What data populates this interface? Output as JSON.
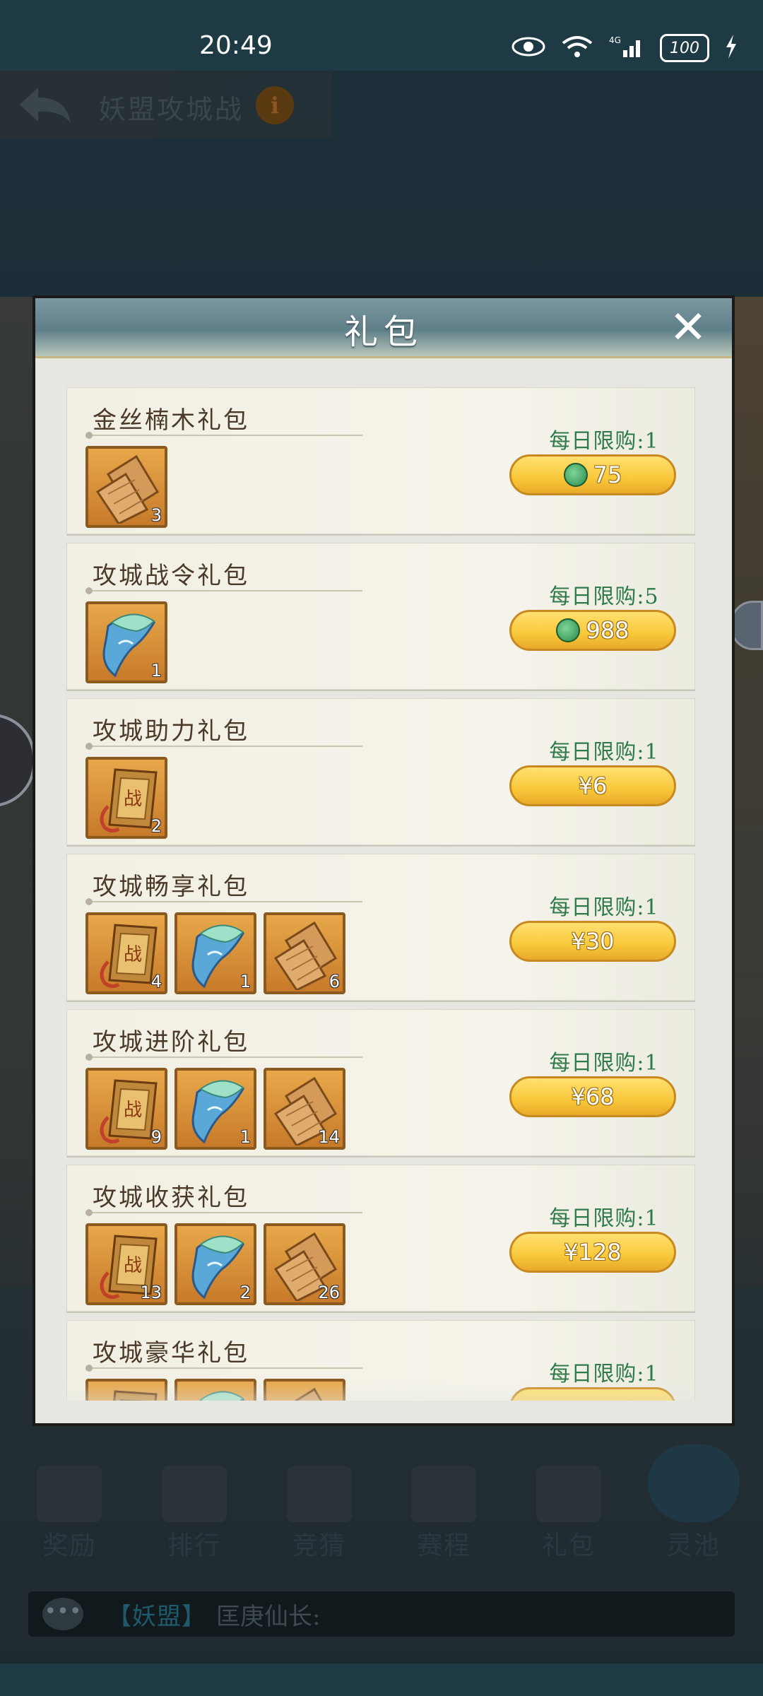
{
  "status_bar": {
    "time": "20:49",
    "battery": "100",
    "network": "4G"
  },
  "header": {
    "title": "妖盟攻城战",
    "info": "i"
  },
  "modal": {
    "title": "礼包",
    "close": "✕",
    "packs": [
      {
        "name": "金丝楠木礼包",
        "limit": "每日限购:1",
        "price": "75",
        "currency": "jade",
        "items": [
          {
            "icon": "wood-plank-icon",
            "count": "3"
          }
        ]
      },
      {
        "name": "攻城战令礼包",
        "limit": "每日限购:5",
        "price": "988",
        "currency": "jade",
        "items": [
          {
            "icon": "blue-shell-icon",
            "count": "1"
          }
        ]
      },
      {
        "name": "攻城助力礼包",
        "limit": "每日限购:1",
        "price": "¥6",
        "currency": "yuan",
        "items": [
          {
            "icon": "war-token-icon",
            "count": "2"
          }
        ]
      },
      {
        "name": "攻城畅享礼包",
        "limit": "每日限购:1",
        "price": "¥30",
        "currency": "yuan",
        "items": [
          {
            "icon": "war-token-icon",
            "count": "4"
          },
          {
            "icon": "blue-shell-icon",
            "count": "1"
          },
          {
            "icon": "wood-plank-icon",
            "count": "6"
          }
        ]
      },
      {
        "name": "攻城进阶礼包",
        "limit": "每日限购:1",
        "price": "¥68",
        "currency": "yuan",
        "items": [
          {
            "icon": "war-token-icon",
            "count": "9"
          },
          {
            "icon": "blue-shell-icon",
            "count": "1"
          },
          {
            "icon": "wood-plank-icon",
            "count": "14"
          }
        ]
      },
      {
        "name": "攻城收获礼包",
        "limit": "每日限购:1",
        "price": "¥128",
        "currency": "yuan",
        "items": [
          {
            "icon": "war-token-icon",
            "count": "13"
          },
          {
            "icon": "blue-shell-icon",
            "count": "2"
          },
          {
            "icon": "wood-plank-icon",
            "count": "26"
          }
        ]
      },
      {
        "name": "攻城豪华礼包",
        "limit": "每日限购:1",
        "price": "",
        "currency": "yuan",
        "items": [
          {
            "icon": "war-token-icon",
            "count": ""
          },
          {
            "icon": "blue-shell-icon",
            "count": ""
          },
          {
            "icon": "wood-plank-icon",
            "count": ""
          }
        ]
      }
    ]
  },
  "nav": {
    "items": [
      {
        "id": "reward",
        "label": "奖励"
      },
      {
        "id": "rank",
        "label": "排行"
      },
      {
        "id": "guess",
        "label": "竞猜"
      },
      {
        "id": "schedule",
        "label": "赛程"
      },
      {
        "id": "gift",
        "label": "礼包"
      },
      {
        "id": "pool",
        "label": "灵池"
      }
    ]
  },
  "chat": {
    "channel": "【妖盟】",
    "user": "匡庚仙长:"
  },
  "colors": {
    "limit_green": "#2f7a4a",
    "gold_button": "#f9c83a",
    "item_frame": "#e8a84a"
  }
}
